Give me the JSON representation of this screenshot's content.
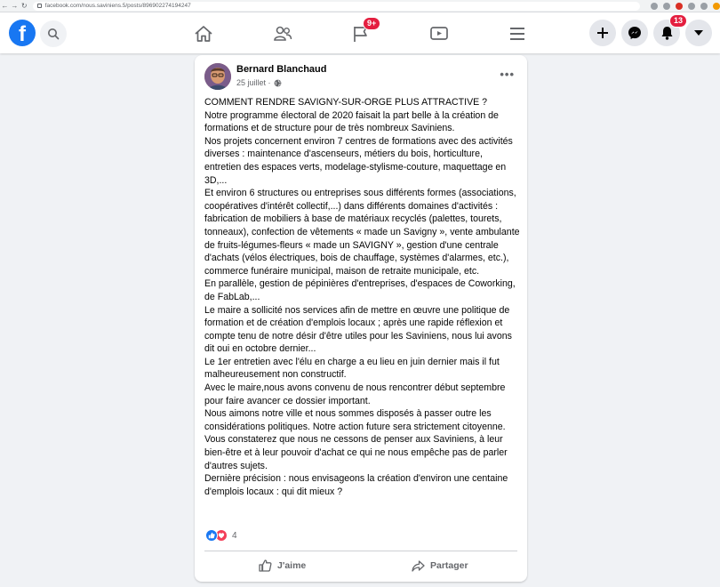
{
  "browser": {
    "url": "facebook.com/nous.saviniens.5/posts/896902274194247"
  },
  "header": {
    "logo_letter": "f",
    "flag_badge": "9+",
    "notifications_badge": "13"
  },
  "post": {
    "author": "Bernard Blanchaud",
    "date": "25 juillet ·",
    "more": "•••",
    "paragraphs": [
      "COMMENT RENDRE SAVIGNY-SUR-ORGE PLUS ATTRACTIVE ?",
      "Notre programme électoral de 2020 faisait la part belle à la création de formations et de structure pour de très nombreux Saviniens.",
      "Nos projets concernent environ 7 centres de formations avec des activités diverses : maintenance d'ascenseurs, métiers du bois, horticulture, entretien des espaces verts, modelage-stylisme-couture, maquettage en 3D,...",
      "Et environ 6 structures ou entreprises sous différents formes (associations, coopératives d'intérêt collectif,...) dans différents domaines d'activités : fabrication de mobiliers à base de matériaux recyclés (palettes, tourets, tonneaux), confection de vêtements « made un Savigny », vente ambulante de fruits-légumes-fleurs « made un SAVIGNY », gestion d'une centrale d'achats (vélos électriques, bois de chauffage, systèmes d'alarmes, etc.), commerce funéraire municipal, maison de retraite municipale, etc.",
      "En parallèle, gestion de pépinières d'entreprises, d'espaces de Coworking, de FabLab,...",
      "Le maire a sollicité nos services afin de mettre en œuvre une politique de formation et de création d'emplois locaux ; après une rapide réflexion et compte tenu de notre désir d'être utiles pour les Saviniens, nous lui avons dit oui en octobre dernier...",
      "Le 1er entretien avec l'élu en charge a eu lieu en juin dernier mais il fut malheureusement non constructif.",
      "Avec le maire,nous avons convenu de nous rencontrer début septembre pour faire avancer ce dossier important.",
      "Nous aimons notre ville et nous sommes disposés à passer outre les considérations politiques. Notre action future sera strictement citoyenne.",
      "Vous constaterez que nous ne cessons de penser aux Saviniens, à leur bien-être et à leur pouvoir d'achat ce qui ne nous empêche pas de parler d'autres sujets.",
      "Dernière précision : nous envisageons la création d'environ une centaine d'emplois locaux : qui dit mieux ?"
    ],
    "reaction_count": "4",
    "like_label": "J'aime",
    "share_label": "Partager"
  },
  "colors": {
    "brand": "#1877f2",
    "badge": "#e41e3f",
    "love": "#f33e58"
  }
}
